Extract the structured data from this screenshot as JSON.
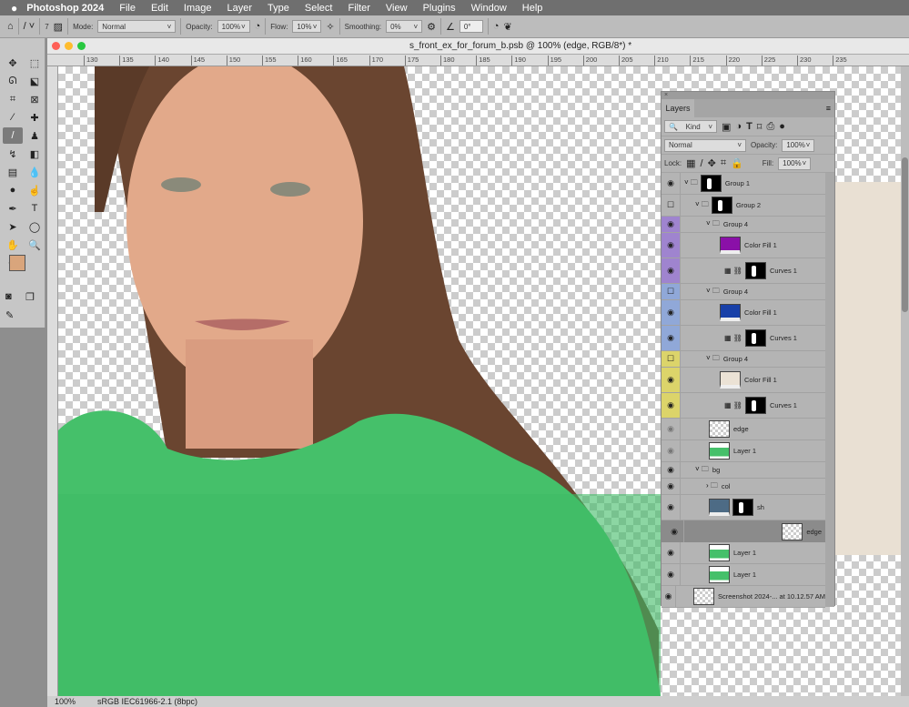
{
  "menubar": {
    "app": "Photoshop 2024",
    "items": [
      "File",
      "Edit",
      "Image",
      "Layer",
      "Type",
      "Select",
      "Filter",
      "View",
      "Plugins",
      "Window",
      "Help"
    ]
  },
  "options": {
    "brush_size": "7",
    "mode_label": "Mode:",
    "mode": "Normal",
    "opacity_label": "Opacity:",
    "opacity": "100%",
    "flow_label": "Flow:",
    "flow": "10%",
    "smoothing_label": "Smoothing:",
    "smoothing": "0%",
    "angle": "0°"
  },
  "document": {
    "title": "s_front_ex_for_forum_b.psb @ 100% (edge, RGB/8*) *",
    "zoom": "100%",
    "profile": "sRGB IEC61966-2.1 (8bpc)"
  },
  "ruler": [
    "130",
    "135",
    "140",
    "145",
    "150",
    "155",
    "160",
    "165",
    "170",
    "175",
    "180",
    "185",
    "190",
    "195",
    "200",
    "205",
    "210",
    "215",
    "220",
    "225",
    "230",
    "235"
  ],
  "colors": {
    "foreground": "#d9a57c",
    "background": "#ffffff",
    "purple_tag": "#9f84cf",
    "blue_tag": "#90a8d8",
    "yellow_tag": "#dcd46a"
  },
  "layers_panel": {
    "title": "Layers",
    "kind": "Kind",
    "blend": "Normal",
    "opacity_label": "Opacity:",
    "opacity": "100%",
    "lock_label": "Lock:",
    "fill_label": "Fill:",
    "fill": "100%",
    "layers": [
      {
        "name": "Group 1",
        "type": "group",
        "indent": 0,
        "visible": true,
        "mask": true,
        "expanded": true
      },
      {
        "name": "Group 2",
        "type": "group",
        "indent": 1,
        "visible": false,
        "mask": true,
        "expanded": true
      },
      {
        "name": "Group 4",
        "type": "group",
        "indent": 2,
        "visible": true,
        "tag": "purple",
        "expanded": true
      },
      {
        "name": "Color Fill 1",
        "type": "fill",
        "indent": 3,
        "visible": true,
        "tag": "purple",
        "fill": "#8a10a8"
      },
      {
        "name": "Curves 1",
        "type": "curves",
        "indent": 3,
        "visible": true,
        "tag": "purple"
      },
      {
        "name": "Group 4",
        "type": "group",
        "indent": 2,
        "visible": false,
        "tag": "blue",
        "expanded": true
      },
      {
        "name": "Color Fill 1",
        "type": "fill",
        "indent": 3,
        "visible": true,
        "tag": "blue",
        "fill": "#1840a8"
      },
      {
        "name": "Curves 1",
        "type": "curves",
        "indent": 3,
        "visible": true,
        "tag": "blue"
      },
      {
        "name": "Group 4",
        "type": "group",
        "indent": 2,
        "visible": false,
        "tag": "yellow",
        "expanded": true
      },
      {
        "name": "Color Fill 1",
        "type": "fill",
        "indent": 3,
        "visible": true,
        "tag": "yellow",
        "fill": "#ebe2d5"
      },
      {
        "name": "Curves 1",
        "type": "curves",
        "indent": 3,
        "visible": true,
        "tag": "yellow"
      },
      {
        "name": "edge",
        "type": "pixel",
        "indent": 2,
        "visible": true,
        "dim": true
      },
      {
        "name": "Layer 1",
        "type": "photo",
        "indent": 2,
        "visible": true,
        "dim": true
      },
      {
        "name": "bg",
        "type": "group",
        "indent": 1,
        "visible": true,
        "expanded": true
      },
      {
        "name": "col",
        "type": "group",
        "indent": 2,
        "visible": true,
        "expanded": false
      },
      {
        "name": "sh",
        "type": "fill",
        "indent": 2,
        "visible": true,
        "fill": "#4d6b85",
        "mask": true
      },
      {
        "name": "edge",
        "type": "pixel",
        "indent": 2,
        "visible": true,
        "selected": true
      },
      {
        "name": "Layer 1",
        "type": "photo",
        "indent": 2,
        "visible": true
      },
      {
        "name": "Layer 1",
        "type": "photo",
        "indent": 2,
        "visible": true
      },
      {
        "name": "Screenshot 2024-... at 10.12.57 AM",
        "type": "pixel",
        "indent": 1,
        "visible": true
      }
    ]
  }
}
